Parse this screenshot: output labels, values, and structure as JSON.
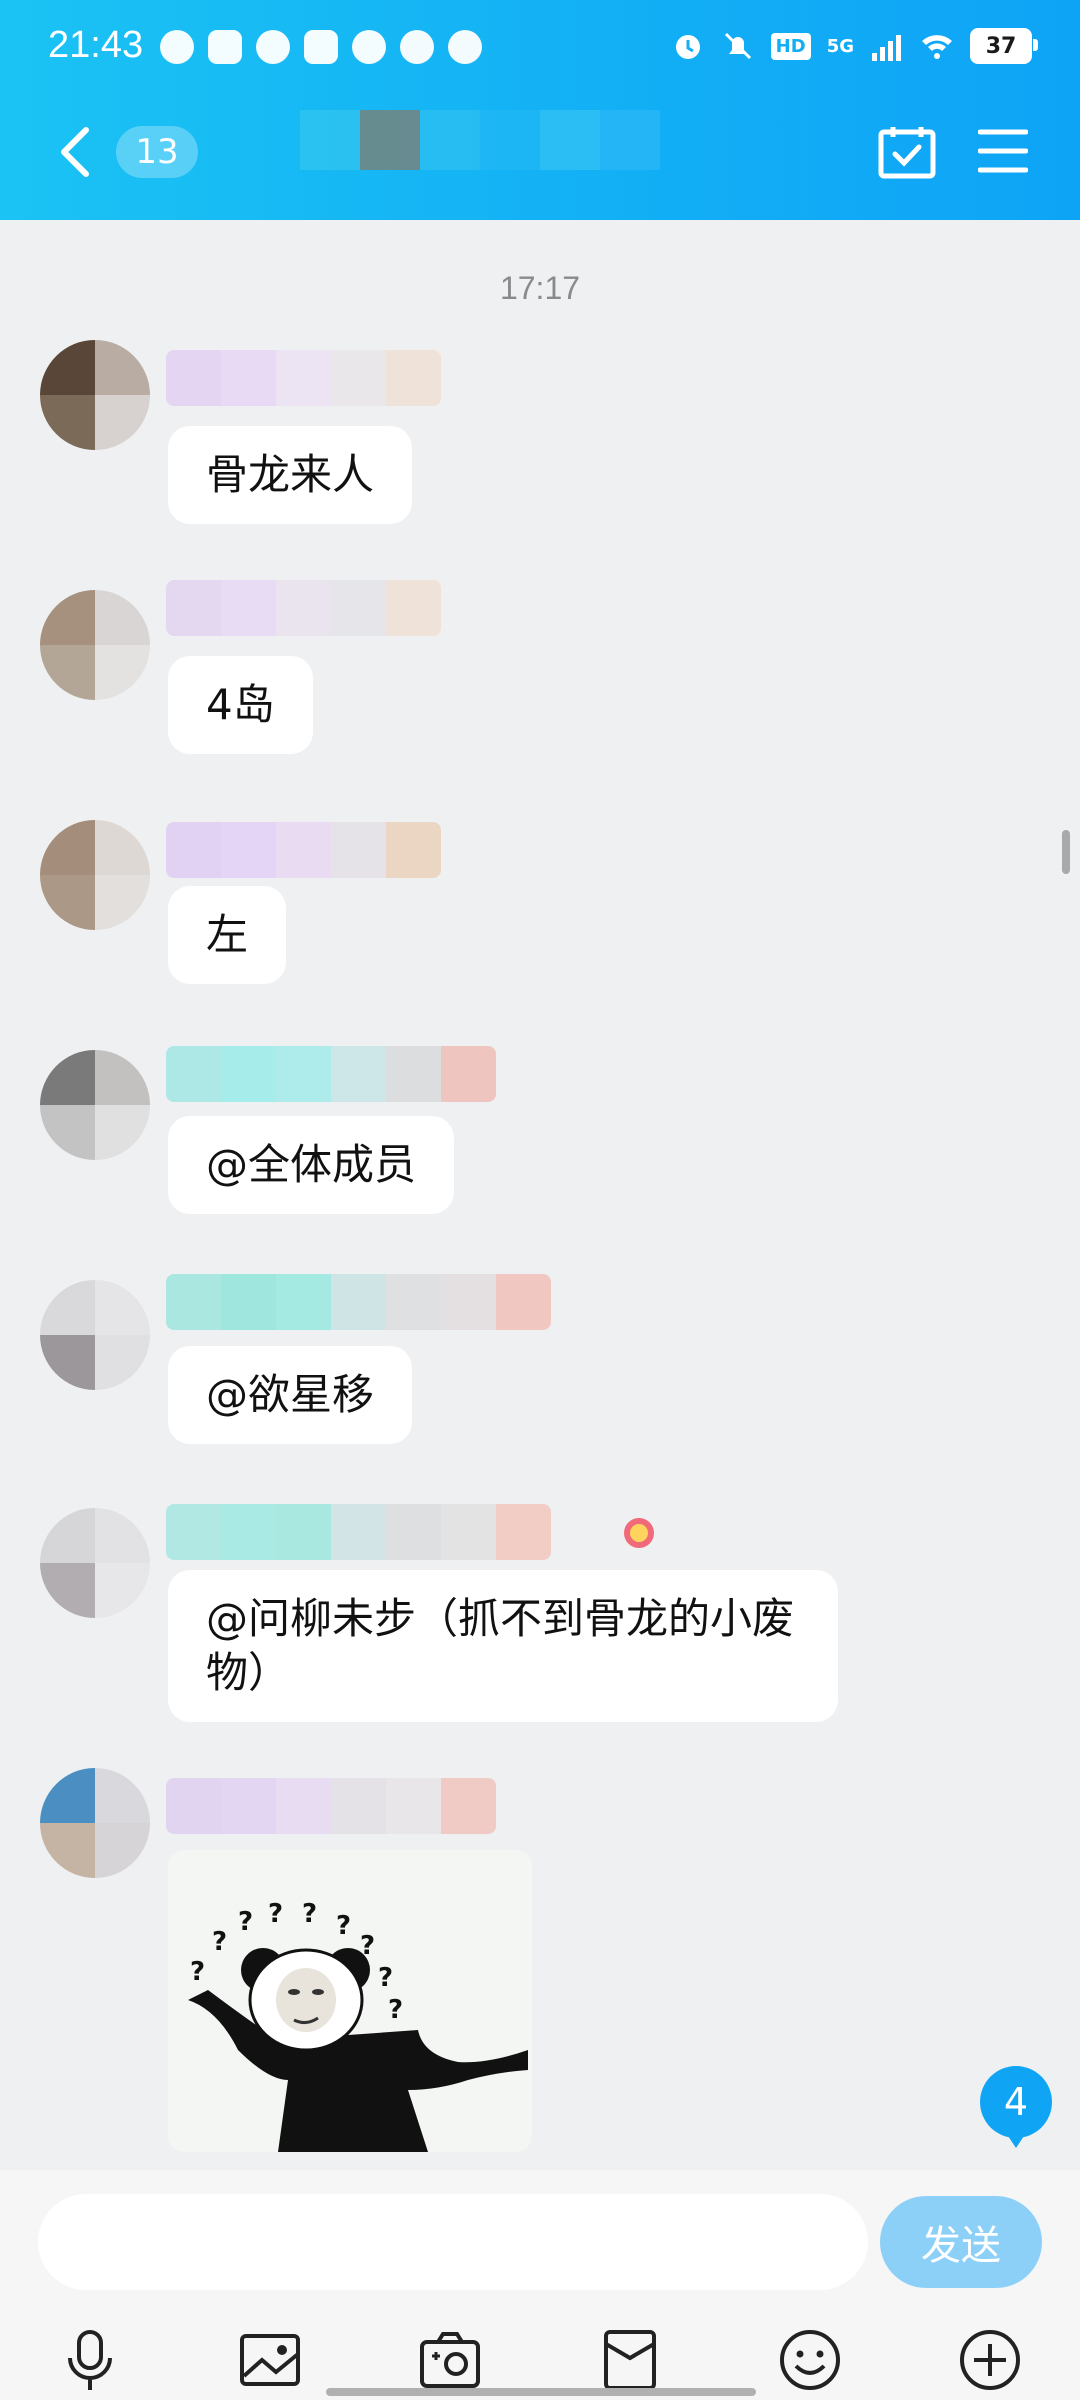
{
  "status_bar": {
    "time": "21:43",
    "network": "5G",
    "hd": "HD",
    "battery": "37"
  },
  "header": {
    "unread_count": "13"
  },
  "chat": {
    "timestamp": "17:17",
    "messages": [
      {
        "text": "骨龙来人"
      },
      {
        "text": "4岛"
      },
      {
        "text": "左"
      },
      {
        "text": "@全体成员"
      },
      {
        "text": "@欲星移"
      },
      {
        "text": "@问柳未步（抓不到骨龙的小废物）"
      }
    ],
    "sticker_marks": "?"
  },
  "new_message_badge": "4",
  "input": {
    "placeholder": "",
    "send_label": "发送"
  },
  "toolbar_icons": [
    "microphone-icon",
    "image-icon",
    "camera-icon",
    "red-packet-icon",
    "emoji-icon",
    "plus-icon"
  ]
}
